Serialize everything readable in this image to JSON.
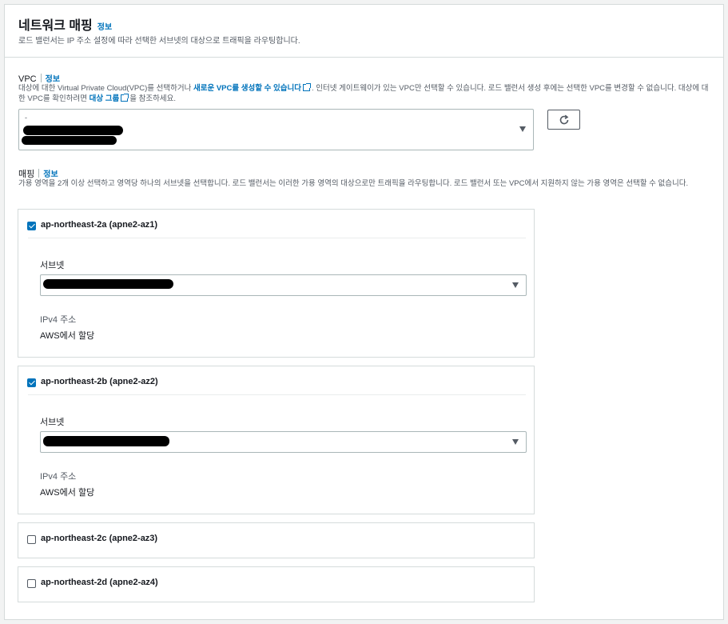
{
  "header": {
    "title": "네트워크 매핑",
    "info": "정보",
    "description": "로드 밸런서는 IP 주소 설정에 따라 선택한 서브넷의 대상으로 트래픽을 라우팅합니다."
  },
  "vpc": {
    "label": "VPC",
    "info": "정보",
    "desc_part1": "대상에 대한 Virtual Private Cloud(VPC)를 선택하거나 ",
    "desc_link1": "새로운 VPC를 생성할 수 있습니다",
    "desc_part2": ". 인터넷 게이트웨이가 있는 VPC만 선택할 수 있습니다. 로드 밸런서 생성 후에는 선택한 VPC를 변경할 수 없습니다. 대상에 대한 VPC를 확인하려면 ",
    "desc_link2": "대상 그룹",
    "desc_part3": "을 참조하세요.",
    "select_prefix": "-",
    "refresh_icon": "refresh-icon"
  },
  "mapping": {
    "label": "매핑",
    "info": "정보",
    "description": "가용 영역을 2개 이상 선택하고 영역당 하나의 서브넷을 선택합니다. 로드 밸런서는 이러한 가용 영역의 대상으로만 트래픽을 라우팅합니다. 로드 밸런서 또는 VPC에서 지원하지 않는 가용 영역은 선택할 수 없습니다.",
    "zones": [
      {
        "name": "ap-northeast-2a (apne2-az1)",
        "checked": true,
        "subnet_label": "서브넷",
        "ipv4_label": "IPv4 주소",
        "ipv4_value": "AWS에서 할당"
      },
      {
        "name": "ap-northeast-2b (apne2-az2)",
        "checked": true,
        "subnet_label": "서브넷",
        "ipv4_label": "IPv4 주소",
        "ipv4_value": "AWS에서 할당"
      },
      {
        "name": "ap-northeast-2c (apne2-az3)",
        "checked": false
      },
      {
        "name": "ap-northeast-2d (apne2-az4)",
        "checked": false
      }
    ]
  },
  "colors": {
    "link": "#0073bb",
    "text": "#16191f",
    "muted": "#545b64",
    "border": "#aab7b8"
  }
}
